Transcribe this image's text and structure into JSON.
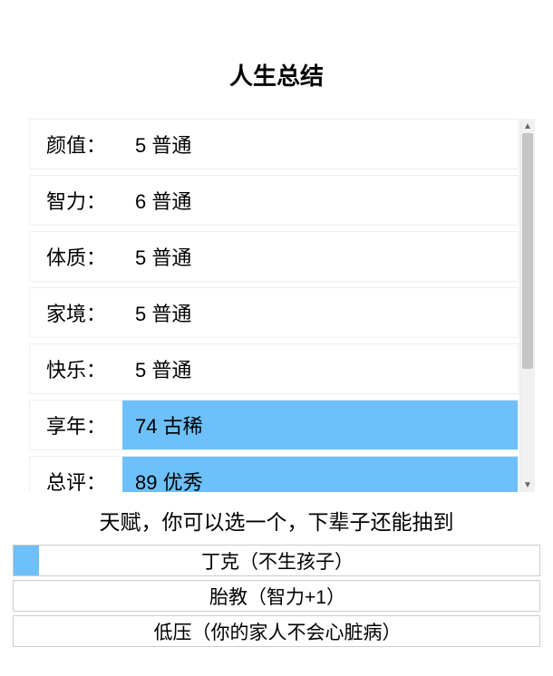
{
  "title": "人生总结",
  "stats": [
    {
      "label": "颜值：",
      "value": "5 普通",
      "highlight": false
    },
    {
      "label": "智力：",
      "value": "6 普通",
      "highlight": false
    },
    {
      "label": "体质：",
      "value": "5 普通",
      "highlight": false
    },
    {
      "label": "家境：",
      "value": "5 普通",
      "highlight": false
    },
    {
      "label": "快乐：",
      "value": "5 普通",
      "highlight": false
    },
    {
      "label": "享年：",
      "value": "74 古稀",
      "highlight": true
    },
    {
      "label": "总评：",
      "value": "89 优秀",
      "highlight": true
    }
  ],
  "talent_hint": "天赋，你可以选一个，下辈子还能抽到",
  "talents": [
    {
      "label": "丁克（不生孩子）",
      "selected": true
    },
    {
      "label": "胎教（智力+1）",
      "selected": false
    },
    {
      "label": "低压（你的家人不会心脏病）",
      "selected": false
    }
  ],
  "colors": {
    "highlight": "#6DC0F9"
  }
}
